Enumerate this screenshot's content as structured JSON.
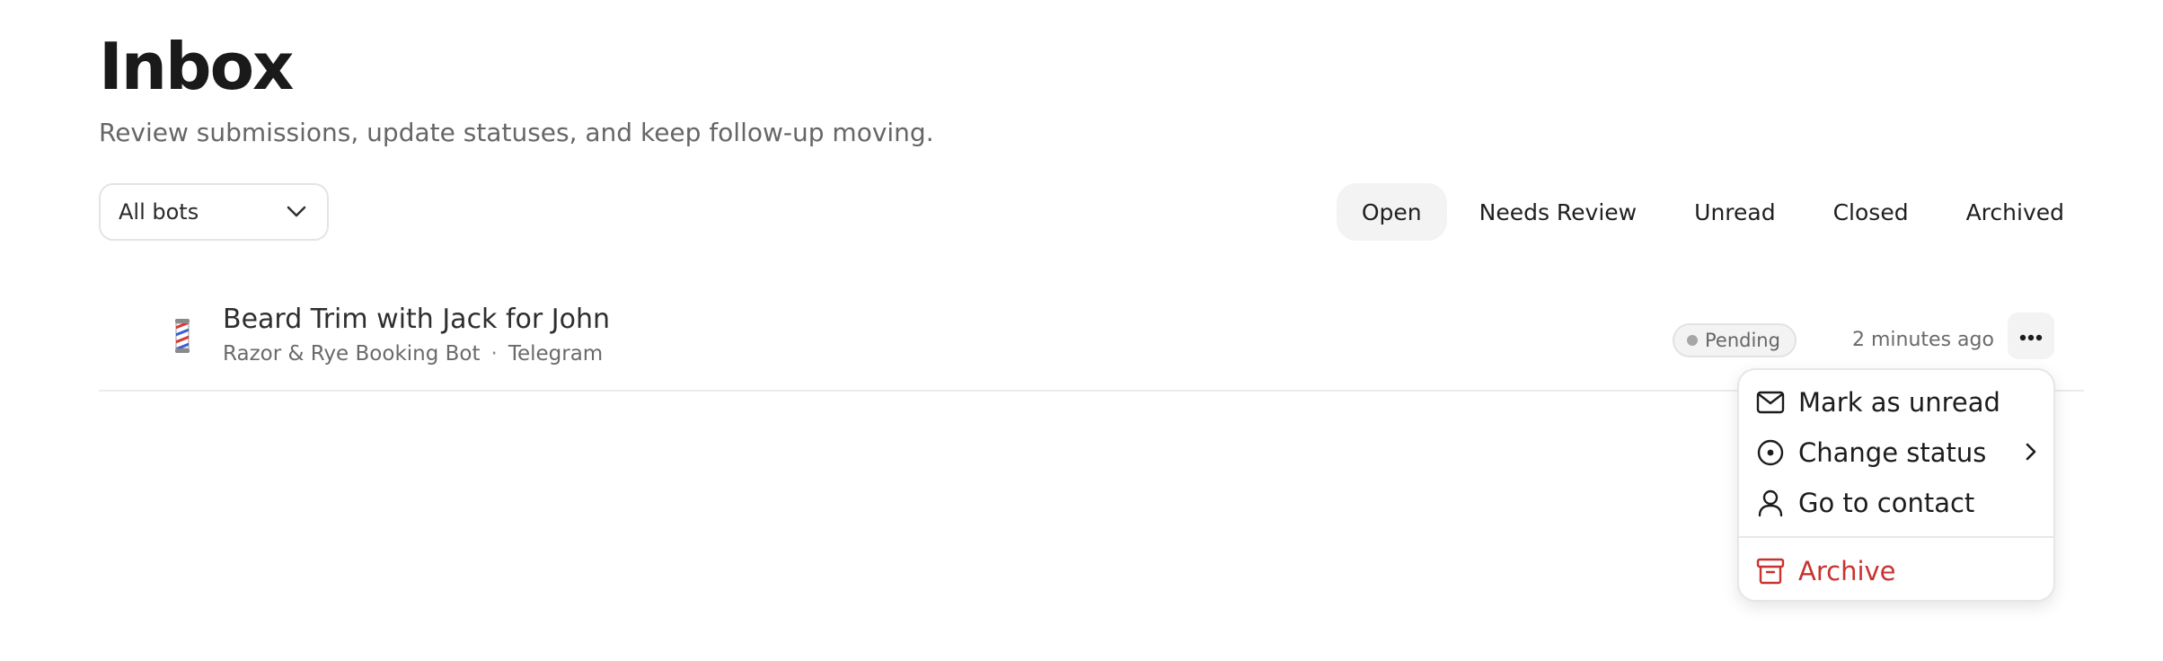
{
  "header": {
    "title": "Inbox",
    "subtitle": "Review submissions, update statuses, and keep follow-up moving."
  },
  "bot_filter": {
    "selected": "All bots"
  },
  "tabs": [
    {
      "label": "Open",
      "active": true
    },
    {
      "label": "Needs Review",
      "active": false
    },
    {
      "label": "Unread",
      "active": false
    },
    {
      "label": "Closed",
      "active": false
    },
    {
      "label": "Archived",
      "active": false
    }
  ],
  "submissions": [
    {
      "icon": "barber-pole-icon",
      "title": "Beard Trim with Jack for John",
      "bot": "Razor & Rye Booking Bot",
      "separator": "·",
      "channel": "Telegram",
      "status": "Pending",
      "time": "2 minutes ago"
    }
  ],
  "row_menu": {
    "items": [
      {
        "label": "Mark as unread",
        "icon": "mail-icon"
      },
      {
        "label": "Change status",
        "icon": "status-circle-icon",
        "has_submenu": true
      },
      {
        "label": "Go to contact",
        "icon": "user-icon"
      },
      {
        "label": "Archive",
        "icon": "archive-icon",
        "danger": true
      }
    ]
  },
  "colors": {
    "danger": "#c8322f",
    "active_tab_bg": "#f3f3f3",
    "status_dot": "#a6a6a6"
  }
}
